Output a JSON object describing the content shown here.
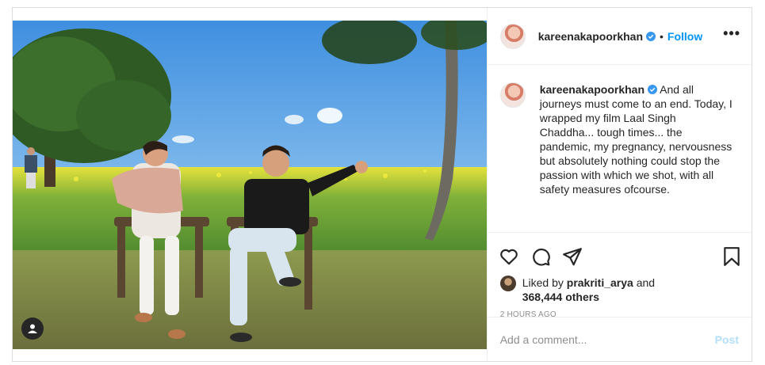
{
  "post": {
    "username": "kareenakapoorkhan",
    "verified_icon": "verified-badge-icon",
    "follow_label": "Follow",
    "separator": "•",
    "more_icon": "more-options-icon",
    "more_label": "•••",
    "caption": "And all journeys must come to an end. Today, I wrapped my film Laal Singh Chaddha... tough times... the pandemic, my pregnancy, nervousness but absolutely nothing could stop the passion with which we shot, with all safety measures ofcourse.",
    "likes": {
      "liked_by_prefix": "Liked by",
      "liked_by_user": "prakriti_arya",
      "conjunction": "and",
      "others": "368,444 others"
    },
    "timestamp": "2 HOURS AGO",
    "comment_placeholder": "Add a comment...",
    "post_label": "Post",
    "accent_color": "#0095f6",
    "icons": [
      "heart-icon",
      "comment-icon",
      "share-icon",
      "bookmark-icon",
      "tag-user-icon"
    ]
  }
}
